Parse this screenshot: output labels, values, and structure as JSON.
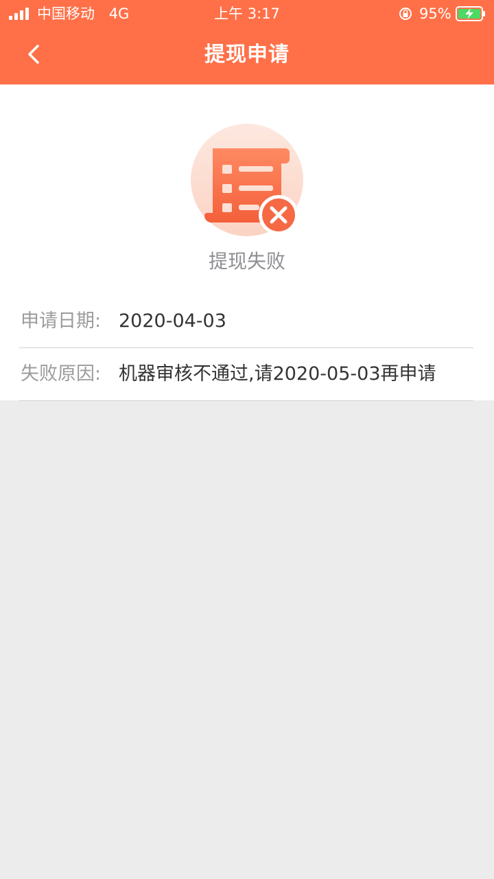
{
  "status_bar": {
    "carrier": "中国移动",
    "network": "4G",
    "time": "上午 3:17",
    "battery_percent": "95%",
    "icons": [
      "signal-icon",
      "rotation-lock-icon",
      "battery-charging-icon"
    ]
  },
  "nav": {
    "title": "提现申请",
    "back_icon": "chevron-left-icon"
  },
  "result": {
    "icon": "document-failed-icon",
    "status_text": "提现失败"
  },
  "details": [
    {
      "label": "申请日期:",
      "value": "2020-04-03"
    },
    {
      "label": "失败原因:",
      "value": "机器审核不通过,请2020-05-03再申请"
    }
  ],
  "colors": {
    "accent": "#ff7048",
    "background": "#ececec",
    "card": "#ffffff",
    "label_text": "#9b9b9b",
    "value_text": "#333333",
    "battery_charge": "#4cd964"
  }
}
